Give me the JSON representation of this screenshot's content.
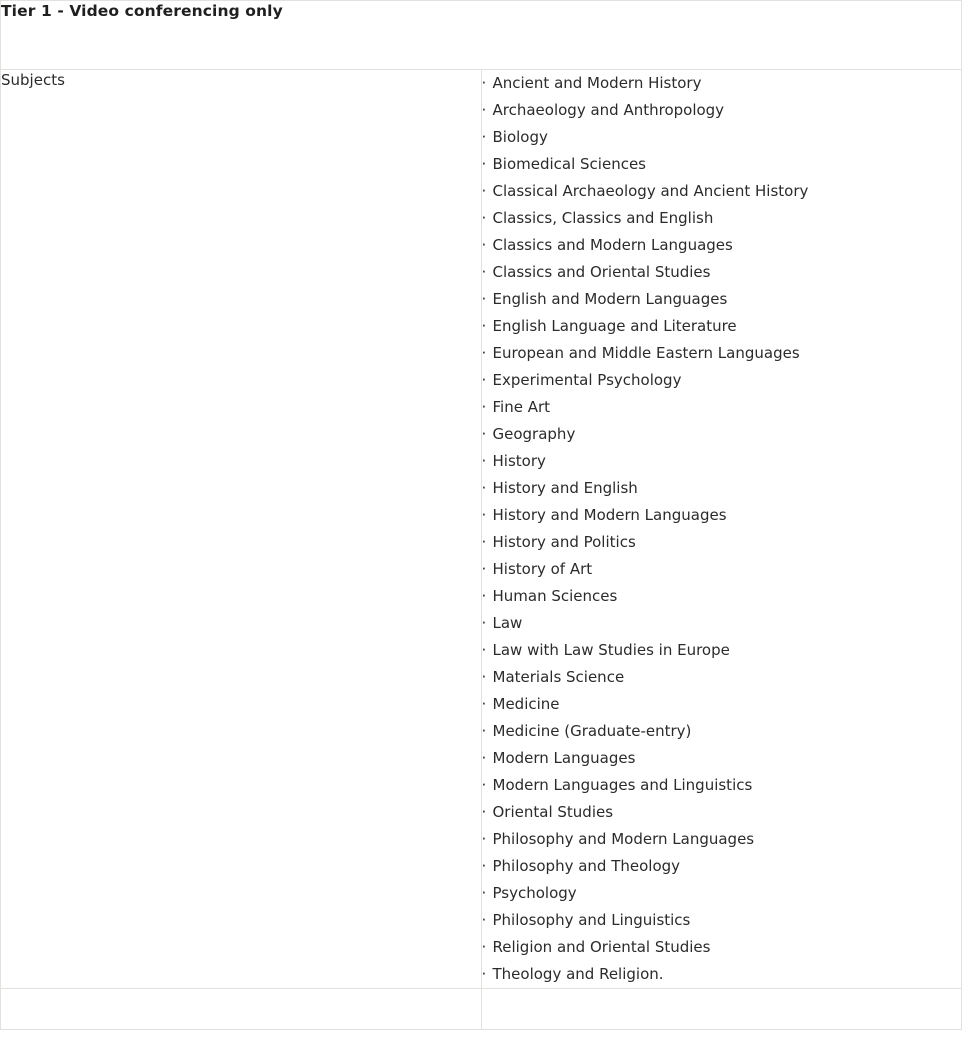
{
  "table": {
    "tier_header": "Tier 1 - Video conferencing only",
    "row_label": "Subjects",
    "bullet_glyph": "·",
    "border_color": "#e3e1dd",
    "text_color": "#2b2b2b",
    "background_color": "#ffffff",
    "subjects": [
      "Ancient and Modern History",
      "Archaeology and Anthropology",
      "Biology",
      "Biomedical Sciences",
      "Classical Archaeology and Ancient History",
      "Classics, Classics and English",
      "Classics and Modern Languages",
      "Classics and Oriental Studies",
      "English and Modern Languages",
      "English Language and Literature",
      "European and Middle Eastern Languages",
      "Experimental Psychology",
      "Fine Art",
      "Geography",
      "History",
      "History and English",
      "History and Modern Languages",
      "History and Politics",
      "History of Art",
      "Human Sciences",
      "Law",
      "Law with Law Studies in Europe",
      "Materials Science",
      "Medicine",
      "Medicine (Graduate-entry)",
      "Modern Languages",
      "Modern Languages and Linguistics",
      "Oriental Studies",
      "Philosophy and Modern Languages",
      "Philosophy and Theology",
      "Psychology",
      "Philosophy and Linguistics",
      "Religion and Oriental Studies",
      "Theology and Religion."
    ]
  }
}
